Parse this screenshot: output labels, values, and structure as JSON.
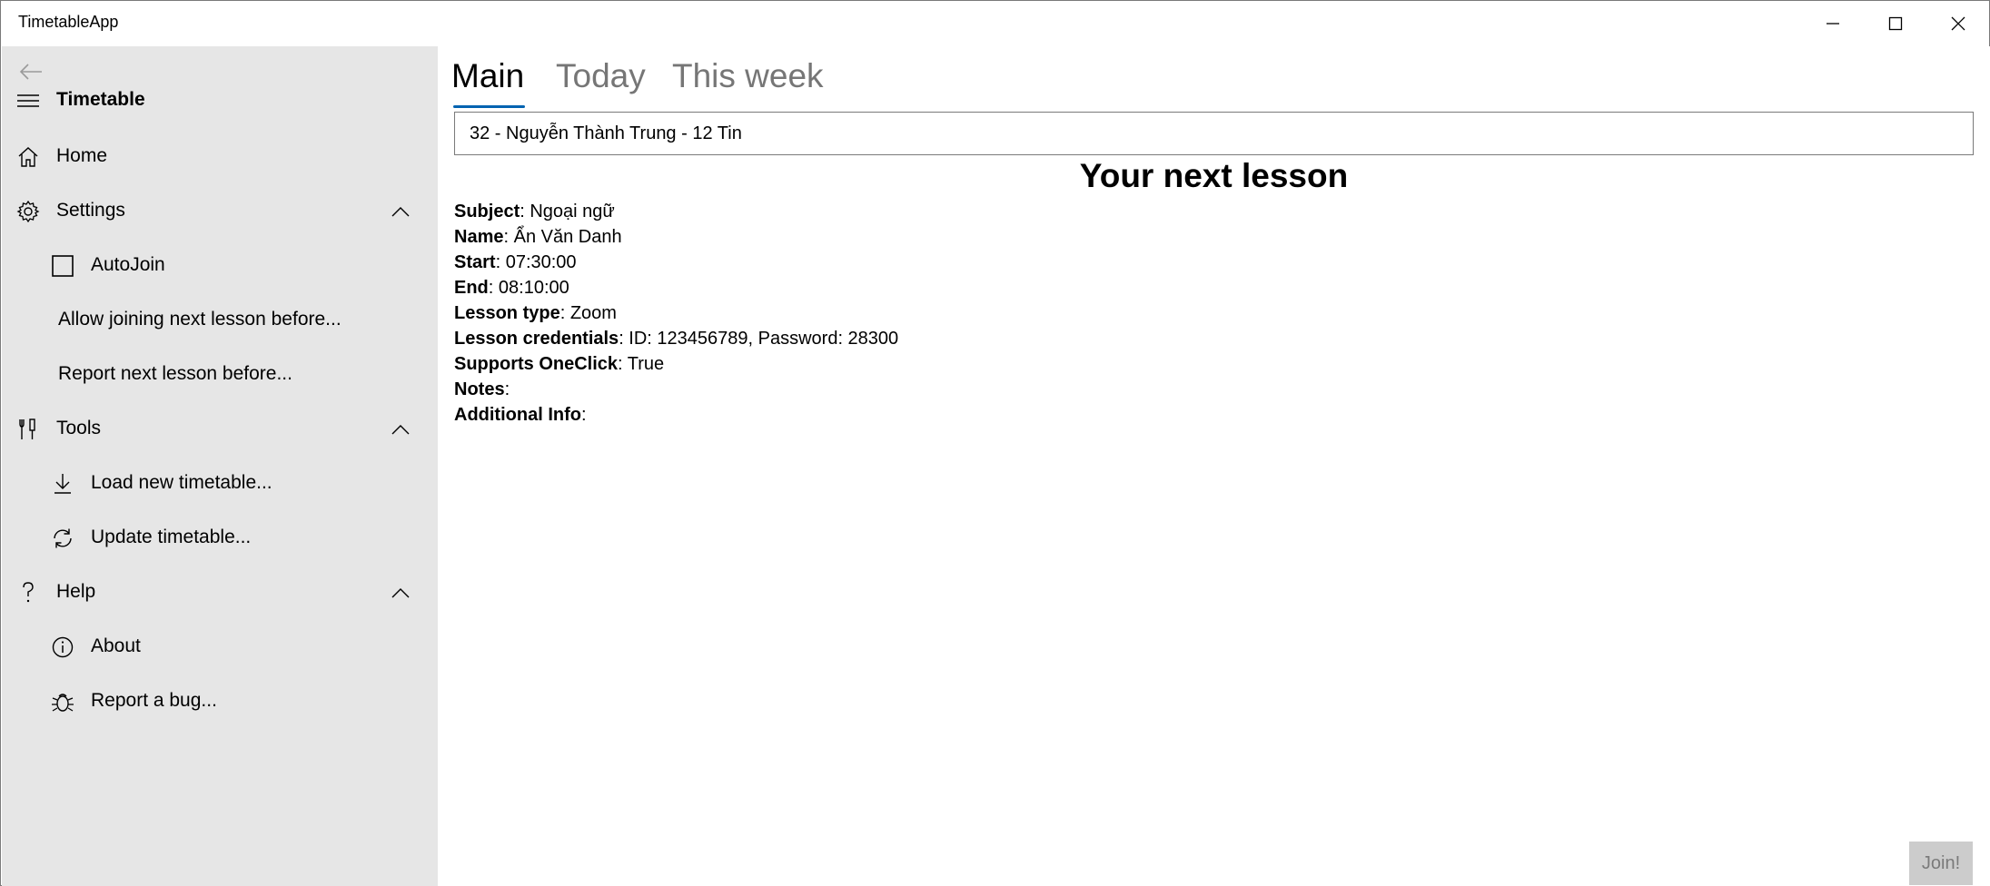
{
  "window": {
    "title": "TimetableApp"
  },
  "sidebar": {
    "header": {
      "label": "Timetable",
      "icon": "hamburger-icon"
    },
    "items": [
      {
        "label": "Home",
        "icon": "home-icon"
      },
      {
        "label": "Settings",
        "icon": "gear-icon",
        "expanded": true
      },
      {
        "label": "AutoJoin",
        "icon": "checkbox-icon",
        "checked": false
      },
      {
        "label": "Allow joining next lesson before..."
      },
      {
        "label": "Report next lesson before..."
      },
      {
        "label": "Tools",
        "icon": "tools-icon",
        "expanded": true
      },
      {
        "label": "Load new timetable...",
        "icon": "download-icon"
      },
      {
        "label": "Update timetable...",
        "icon": "refresh-icon"
      },
      {
        "label": "Help",
        "icon": "question-icon",
        "expanded": true
      },
      {
        "label": "About",
        "icon": "info-icon"
      },
      {
        "label": "Report a bug...",
        "icon": "bug-icon"
      }
    ]
  },
  "tabs": [
    {
      "label": "Main",
      "active": true
    },
    {
      "label": "Today",
      "active": false
    },
    {
      "label": "This week",
      "active": false
    }
  ],
  "student_selector": {
    "value": "32 - Nguyễn Thành Trung - 12 Tin"
  },
  "next_lesson": {
    "heading": "Your next lesson",
    "fields": [
      {
        "key": "Subject",
        "value": ": Ngoại ngữ"
      },
      {
        "key": "Name",
        "value": ": Ẩn Văn Danh"
      },
      {
        "key": "Start",
        "value": ": 07:30:00"
      },
      {
        "key": "End",
        "value": ": 08:10:00"
      },
      {
        "key": "Lesson type",
        "value": ": Zoom"
      },
      {
        "key": "Lesson credentials",
        "value": ": ID: 123456789, Password: 28300"
      },
      {
        "key": "Supports OneClick",
        "value": ": True"
      },
      {
        "key": "Notes",
        "value": ":"
      },
      {
        "key": "Additional Info",
        "value": ":"
      }
    ]
  },
  "join_button": {
    "label": "Join!",
    "enabled": false
  },
  "colors": {
    "sidebar_bg": "#e6e6e6",
    "accent": "#0063b1",
    "inactive_tab": "#767676",
    "disabled_button_bg": "#cccccc"
  }
}
